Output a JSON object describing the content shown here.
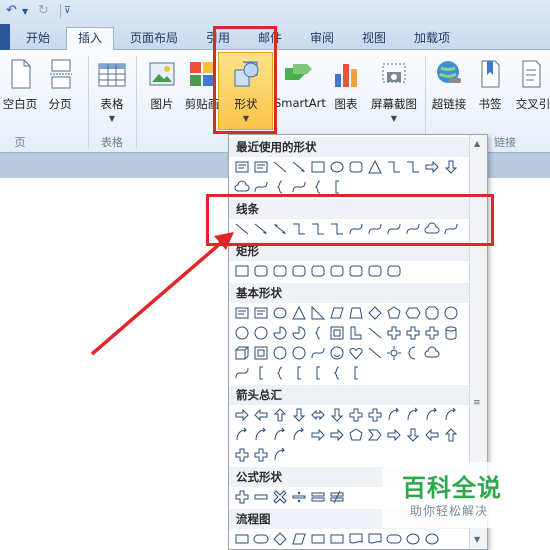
{
  "tabs": [
    {
      "label": "开始",
      "active": false
    },
    {
      "label": "插入",
      "active": true
    },
    {
      "label": "页面布局",
      "active": false
    },
    {
      "label": "引用",
      "active": false
    },
    {
      "label": "邮件",
      "active": false
    },
    {
      "label": "审阅",
      "active": false
    },
    {
      "label": "视图",
      "active": false
    },
    {
      "label": "加载项",
      "active": false
    }
  ],
  "ribbon": {
    "buttons": [
      {
        "label": "空白页",
        "icon": "blank-page-icon"
      },
      {
        "label": "分页",
        "icon": "page-break-icon"
      },
      {
        "label": "表格",
        "icon": "table-icon"
      },
      {
        "label": "图片",
        "icon": "picture-icon"
      },
      {
        "label": "剪贴画",
        "icon": "clip-art-icon"
      },
      {
        "label": "形状",
        "icon": "shapes-icon"
      },
      {
        "label": "SmartArt",
        "icon": "smartart-icon"
      },
      {
        "label": "图表",
        "icon": "chart-icon"
      },
      {
        "label": "屏幕截图",
        "icon": "screenshot-icon"
      },
      {
        "label": "超链接",
        "icon": "hyperlink-icon"
      },
      {
        "label": "书签",
        "icon": "bookmark-icon"
      },
      {
        "label": "交叉引",
        "icon": "cross-reference-icon"
      }
    ],
    "groups": [
      "页",
      "表格",
      "链接"
    ]
  },
  "shapes_panel": {
    "sections": [
      {
        "title": "最近使用的形状"
      },
      {
        "title": "线条"
      },
      {
        "title": "矩形"
      },
      {
        "title": "基本形状"
      },
      {
        "title": "箭头总汇"
      },
      {
        "title": "公式形状"
      },
      {
        "title": "流程图"
      }
    ]
  },
  "watermark": {
    "title": "百科全说",
    "subtitle": "助你轻松解决"
  },
  "colors": {
    "accent_red": "#e0262a",
    "ribbon_highlight": "#f9c54a",
    "watermark_green": "#2fa84c"
  }
}
